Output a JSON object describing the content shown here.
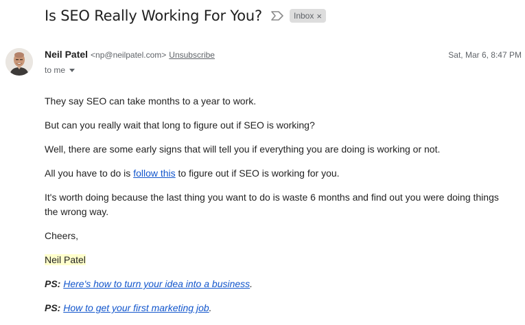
{
  "email": {
    "subject": "Is SEO Really Working For You?",
    "label": "Inbox",
    "label_close": "×",
    "sender_name": "Neil Patel",
    "sender_email": "<np@neilpatel.com>",
    "unsubscribe": "Unsubscribe",
    "date": "Sat, Mar 6, 8:47 PM",
    "recipient": "to me"
  },
  "body": {
    "p1": "They say SEO can take months to a year to work.",
    "p2": "But can you really wait that long to figure out if SEO is working?",
    "p3": "Well, there are some early signs that will tell you if everything you are doing is working or not.",
    "p4_before": "All you have to do is ",
    "p4_link": "follow this",
    "p4_after": " to figure out if SEO is working for you.",
    "p5": "It's worth doing because the last thing you want to do is waste 6 months and find out you were doing things the wrong way.",
    "closing": "Cheers,",
    "signature": "Neil Patel",
    "ps1_label": "PS:",
    "ps1_link": "Here's how to turn your idea into a business",
    "ps1_end": ".",
    "ps2_label": "PS:",
    "ps2_link": "How to get your first marketing job",
    "ps2_end": "."
  },
  "icons": {
    "important": "important-marker-icon",
    "avatar": "sender-avatar"
  },
  "colors": {
    "link": "#1155cc",
    "signature_highlight": "#ffffcc",
    "label_chip": "#dddddd"
  }
}
